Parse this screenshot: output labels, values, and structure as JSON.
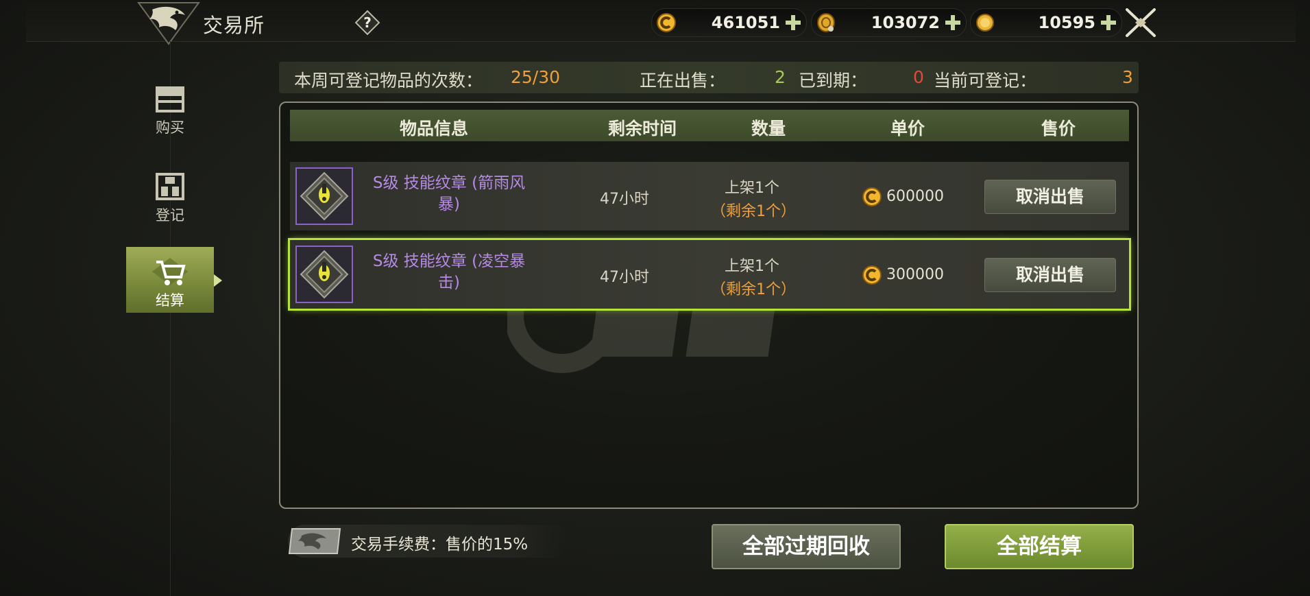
{
  "header": {
    "title": "交易所",
    "help_label": "?",
    "currencies": [
      {
        "icon": "gold-coin-icon",
        "value": "461051"
      },
      {
        "icon": "medal-coin-icon",
        "value": "103072"
      },
      {
        "icon": "gem-coin-icon",
        "value": "10595"
      }
    ]
  },
  "sidebar": {
    "items": [
      {
        "label": "购买",
        "icon": "shop-icon",
        "active": false
      },
      {
        "label": "登记",
        "icon": "register-icon",
        "active": false
      },
      {
        "label": "结算",
        "icon": "cart-icon",
        "active": true
      }
    ]
  },
  "stats": {
    "weekly_label": "本周可登记物品的次数：",
    "weekly_value": "25/30",
    "selling_label": "正在出售：",
    "selling_value": "2",
    "expired_label": "已到期：",
    "expired_value": "0",
    "available_label": "当前可登记：",
    "available_value": "3"
  },
  "table": {
    "headers": [
      "物品信息",
      "剩余时间",
      "数量",
      "单价",
      "售价"
    ],
    "rows": [
      {
        "name": "S级 技能纹章 (箭雨风暴)",
        "time": "47小时",
        "qty_listed": "上架1个",
        "qty_remaining": "（剩余1个）",
        "price": "600000",
        "action": "取消出售",
        "selected": false
      },
      {
        "name": "S级 技能纹章 (凌空暴击)",
        "time": "47小时",
        "qty_listed": "上架1个",
        "qty_remaining": "（剩余1个）",
        "price": "300000",
        "action": "取消出售",
        "selected": true
      }
    ]
  },
  "footer": {
    "fee_text": "交易手续费：售价的15%",
    "recycle_all_label": "全部过期回收",
    "settle_all_label": "全部结算"
  },
  "colors": {
    "accent_green": "#a7c95a",
    "orange": "#f0a03a",
    "red": "#e5483a",
    "item_purple": "#b78ae8",
    "selected_outline": "#b6e23c"
  }
}
